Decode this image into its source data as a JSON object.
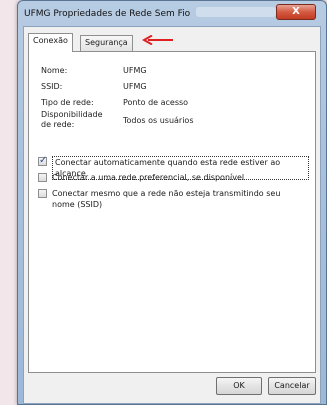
{
  "window": {
    "title": "UFMG Propriedades de Rede Sem Fio",
    "close_glyph": "X"
  },
  "tabs": [
    {
      "label": "Conexão",
      "active": true
    },
    {
      "label": "Segurança",
      "active": false
    }
  ],
  "arrow_color": "#e02020",
  "details": {
    "name_label": "Nome:",
    "name_value": "UFMG",
    "ssid_label": "SSID:",
    "ssid_value": "UFMG",
    "type_label": "Tipo de rede:",
    "type_value": "Ponto de acesso",
    "avail_label": "Disponibilidade de rede:",
    "avail_value": "Todos os usuários"
  },
  "options": [
    {
      "label": "Conectar automaticamente quando esta rede estiver ao alcance",
      "checked": true
    },
    {
      "label": "Conectar a uma rede preferencial, se disponível",
      "checked": false
    },
    {
      "label": "Conectar mesmo que a rede não esteja transmitindo seu nome (SSID)",
      "checked": false
    }
  ],
  "buttons": {
    "ok": "OK",
    "cancel": "Cancelar"
  }
}
